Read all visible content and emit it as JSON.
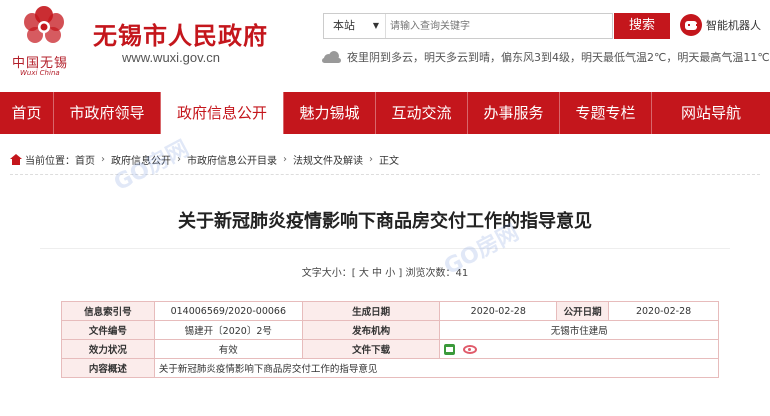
{
  "header": {
    "logo_text_cn": "中国无锡",
    "logo_text_en": "Wuxi China",
    "site_title": "无锡市人民政府",
    "site_url": "www.wuxi.gov.cn"
  },
  "search": {
    "scope": "本站",
    "placeholder": "请输入查询关键字",
    "button_label": "搜索"
  },
  "robot_label": "智能机器人",
  "weather_text": "夜里阴到多云，明天多云到晴，偏东风3到4级，明天最低气温2℃，明天最高气温11℃",
  "nav": {
    "items": [
      {
        "label": "首页"
      },
      {
        "label": "市政府领导"
      },
      {
        "label": "政府信息公开"
      },
      {
        "label": "魅力锡城"
      },
      {
        "label": "互动交流"
      },
      {
        "label": "办事服务"
      },
      {
        "label": "专题专栏"
      },
      {
        "label": "网站导航"
      }
    ],
    "active_index": 2
  },
  "breadcrumb": {
    "prefix": "当前位置：",
    "items": [
      "首页",
      "政府信息公开",
      "市政府信息公开目录",
      "法规文件及解读",
      "正文"
    ]
  },
  "article": {
    "title": "关于新冠肺炎疫情影响下商品房交付工作的指导意见",
    "meta": "文字大小：[ 大 中 小 ]  浏览次数：41"
  },
  "info_table": {
    "index_no_label": "信息索引号",
    "index_no": "014006569/2020-00066",
    "created_label": "生成日期",
    "created": "2020-02-28",
    "published_label": "公开日期",
    "published": "2020-02-28",
    "doc_no_label": "文件编号",
    "doc_no": "锡建开〔2020〕2号",
    "issuer_label": "发布机构",
    "issuer": "无锡市住建局",
    "status_label": "效力状况",
    "status": "有效",
    "download_label": "文件下载",
    "summary_label": "内容概述",
    "summary": "关于新冠肺炎疫情影响下商品房交付工作的指导意见"
  },
  "watermark": "GO房网",
  "colors": {
    "brand_red": "#c4161c",
    "table_label_bg": "#fbeceb"
  }
}
